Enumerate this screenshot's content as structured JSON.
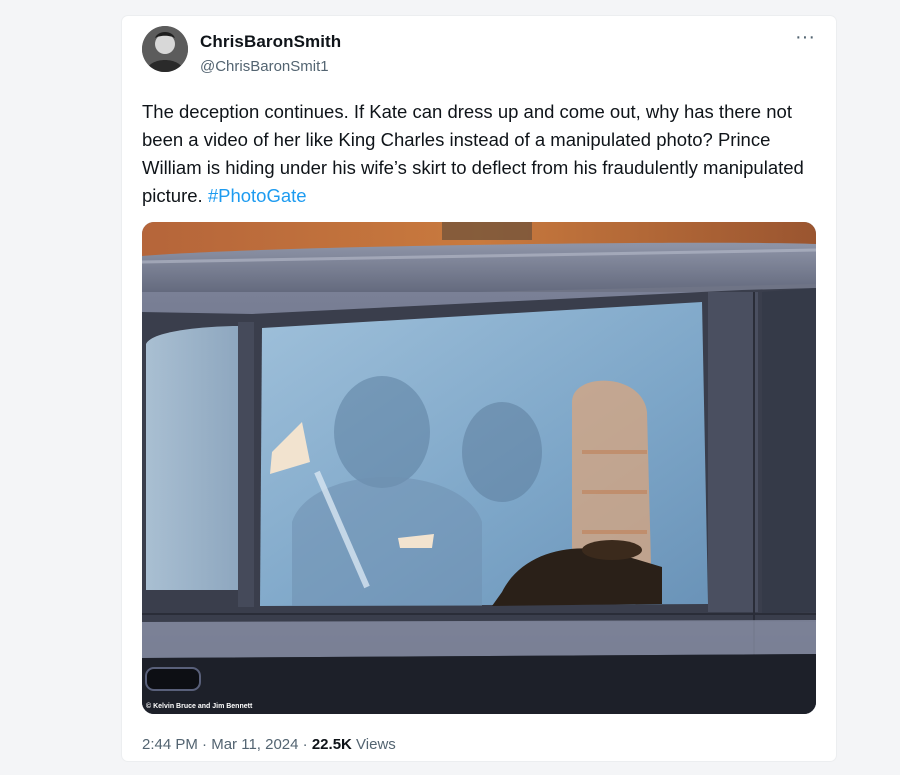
{
  "author": {
    "display_name": "ChrisBaronSmith",
    "handle": "@ChrisBaronSmit1"
  },
  "menu_icon": "more-horizontal-icon",
  "tweet": {
    "text": "The deception continues. If Kate can dress up and come out, why has there not been a video of her like King Charles instead of a manipulated photo? Prince William is hiding under his wife’s skirt to deflect from his fraudulently manipulated picture. ",
    "hashtag": "#PhotoGate"
  },
  "photo": {
    "credit": "© Kelvin Bruce and Jim Bennett"
  },
  "meta": {
    "time": "2:44 PM",
    "separator1": " · ",
    "date": "Mar 11, 2024",
    "separator2": " · ",
    "views_count": "22.5K",
    "views_label": " Views"
  },
  "colors": {
    "link": "#1d9bf0",
    "text": "#0f1419",
    "secondary": "#536471"
  }
}
